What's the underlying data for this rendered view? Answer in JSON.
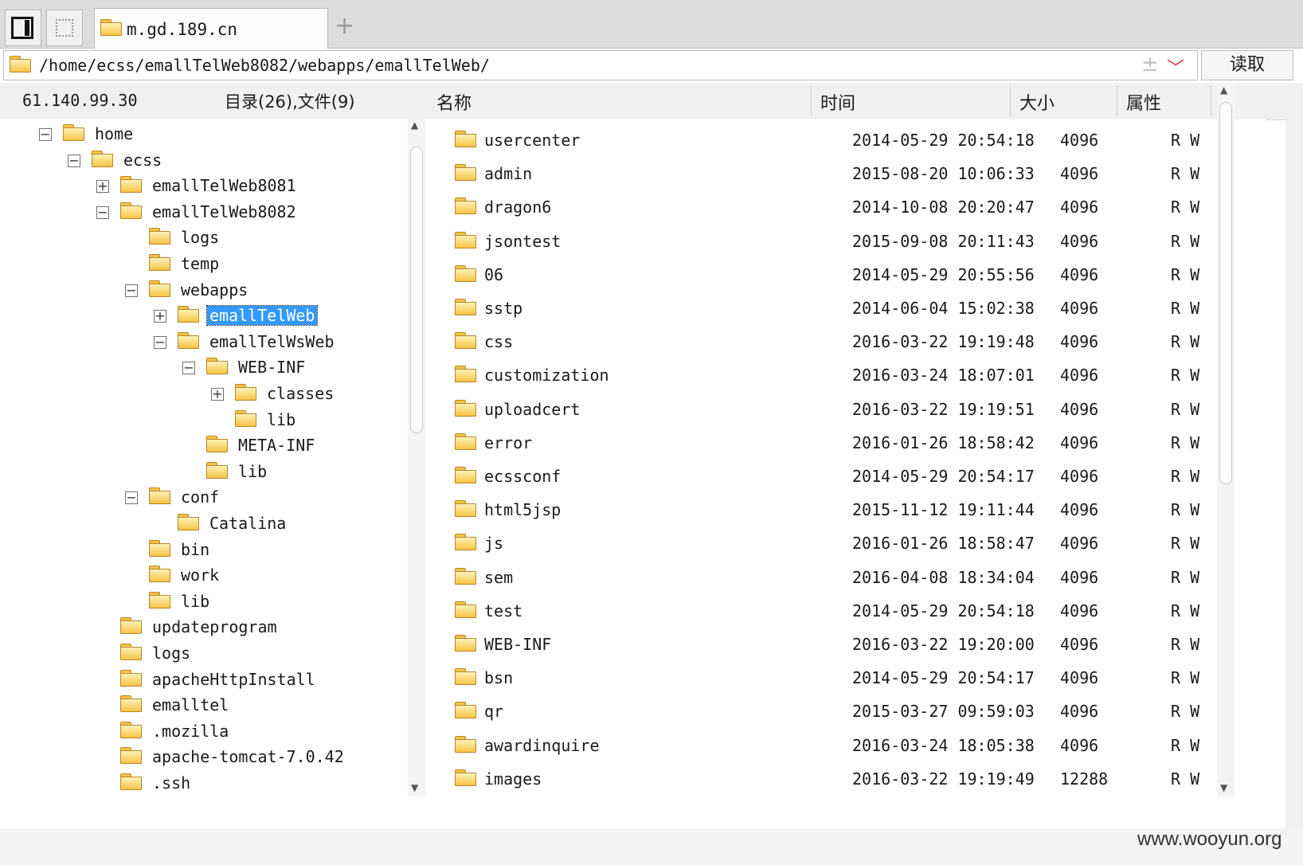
{
  "tab": {
    "title": "m.gd.189.cn",
    "add_label": "+"
  },
  "pathbar": {
    "path": "/home/ecss/emallTelWeb8082/webapps/emallTelWeb/",
    "read_label": "读取"
  },
  "header": {
    "ip": "61.140.99.30",
    "count": "目录(26),文件(9)",
    "col_name": "名称",
    "col_time": "时间",
    "col_size": "大小",
    "col_attr": "属性"
  },
  "tree": [
    {
      "label": "home",
      "depth": 0,
      "toggle": "−"
    },
    {
      "label": "ecss",
      "depth": 1,
      "toggle": "−"
    },
    {
      "label": "emallTelWeb8081",
      "depth": 2,
      "toggle": "+"
    },
    {
      "label": "emallTelWeb8082",
      "depth": 2,
      "toggle": "−"
    },
    {
      "label": "logs",
      "depth": 3,
      "toggle": ""
    },
    {
      "label": "temp",
      "depth": 3,
      "toggle": ""
    },
    {
      "label": "webapps",
      "depth": 3,
      "toggle": "−"
    },
    {
      "label": "emallTelWeb",
      "depth": 4,
      "toggle": "+",
      "selected": true
    },
    {
      "label": "emallTelWsWeb",
      "depth": 4,
      "toggle": "−"
    },
    {
      "label": "WEB-INF",
      "depth": 5,
      "toggle": "−"
    },
    {
      "label": "classes",
      "depth": 6,
      "toggle": "+"
    },
    {
      "label": "lib",
      "depth": 6,
      "toggle": ""
    },
    {
      "label": "META-INF",
      "depth": 5,
      "toggle": ""
    },
    {
      "label": "lib",
      "depth": 5,
      "toggle": ""
    },
    {
      "label": "conf",
      "depth": 3,
      "toggle": "−"
    },
    {
      "label": "Catalina",
      "depth": 4,
      "toggle": ""
    },
    {
      "label": "bin",
      "depth": 3,
      "toggle": ""
    },
    {
      "label": "work",
      "depth": 3,
      "toggle": ""
    },
    {
      "label": "lib",
      "depth": 3,
      "toggle": ""
    },
    {
      "label": "updateprogram",
      "depth": 2,
      "toggle": ""
    },
    {
      "label": "logs",
      "depth": 2,
      "toggle": ""
    },
    {
      "label": "apacheHttpInstall",
      "depth": 2,
      "toggle": ""
    },
    {
      "label": "emalltel",
      "depth": 2,
      "toggle": ""
    },
    {
      "label": ".mozilla",
      "depth": 2,
      "toggle": ""
    },
    {
      "label": "apache-tomcat-7.0.42",
      "depth": 2,
      "toggle": ""
    },
    {
      "label": ".ssh",
      "depth": 2,
      "toggle": ""
    }
  ],
  "files": [
    {
      "name": "usercenter",
      "time": "2014-05-29 20:54:18",
      "size": "4096",
      "attr": "R W"
    },
    {
      "name": "admin",
      "time": "2015-08-20 10:06:33",
      "size": "4096",
      "attr": "R W"
    },
    {
      "name": "dragon6",
      "time": "2014-10-08 20:20:47",
      "size": "4096",
      "attr": "R W"
    },
    {
      "name": "jsontest",
      "time": "2015-09-08 20:11:43",
      "size": "4096",
      "attr": "R W"
    },
    {
      "name": "06",
      "time": "2014-05-29 20:55:56",
      "size": "4096",
      "attr": "R W"
    },
    {
      "name": "sstp",
      "time": "2014-06-04 15:02:38",
      "size": "4096",
      "attr": "R W"
    },
    {
      "name": "css",
      "time": "2016-03-22 19:19:48",
      "size": "4096",
      "attr": "R W"
    },
    {
      "name": "customization",
      "time": "2016-03-24 18:07:01",
      "size": "4096",
      "attr": "R W"
    },
    {
      "name": "uploadcert",
      "time": "2016-03-22 19:19:51",
      "size": "4096",
      "attr": "R W"
    },
    {
      "name": "error",
      "time": "2016-01-26 18:58:42",
      "size": "4096",
      "attr": "R W"
    },
    {
      "name": "ecssconf",
      "time": "2014-05-29 20:54:17",
      "size": "4096",
      "attr": "R W"
    },
    {
      "name": "html5jsp",
      "time": "2015-11-12 19:11:44",
      "size": "4096",
      "attr": "R W"
    },
    {
      "name": "js",
      "time": "2016-01-26 18:58:47",
      "size": "4096",
      "attr": "R W"
    },
    {
      "name": "sem",
      "time": "2016-04-08 18:34:04",
      "size": "4096",
      "attr": "R W"
    },
    {
      "name": "test",
      "time": "2014-05-29 20:54:18",
      "size": "4096",
      "attr": "R W"
    },
    {
      "name": "WEB-INF",
      "time": "2016-03-22 19:20:00",
      "size": "4096",
      "attr": "R W"
    },
    {
      "name": "bsn",
      "time": "2014-05-29 20:54:17",
      "size": "4096",
      "attr": "R W"
    },
    {
      "name": "qr",
      "time": "2015-03-27 09:59:03",
      "size": "4096",
      "attr": "R W"
    },
    {
      "name": "awardinquire",
      "time": "2016-03-24 18:05:38",
      "size": "4096",
      "attr": "R W"
    },
    {
      "name": "images",
      "time": "2016-03-22 19:19:49",
      "size": "12288",
      "attr": "R W"
    }
  ],
  "watermark": "www.wooyun.org"
}
